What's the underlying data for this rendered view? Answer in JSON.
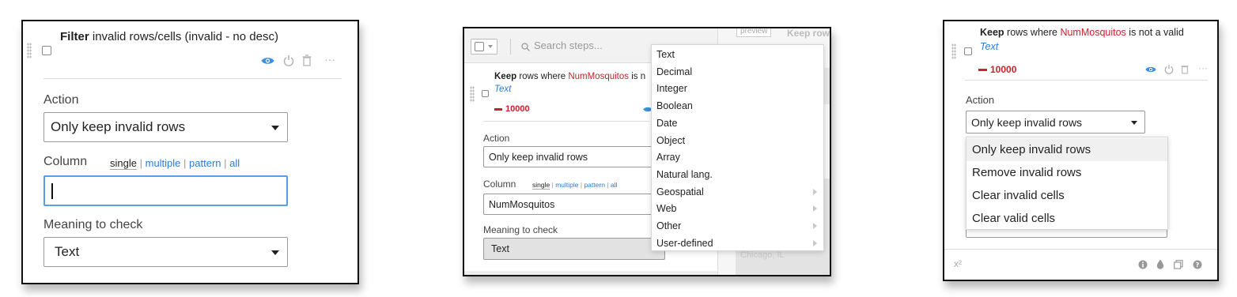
{
  "panel1": {
    "title_strong": "Filter",
    "title_rest": " invalid rows/cells (invalid - no desc)",
    "action_label": "Action",
    "action_value": "Only keep invalid rows",
    "column_label": "Column",
    "mode_single": "single",
    "mode_multiple": "multiple",
    "mode_pattern": "pattern",
    "mode_all": "all",
    "sep": "|",
    "meaning_label": "Meaning to check",
    "meaning_value": "Text"
  },
  "panel2": {
    "search_placeholder": "Search steps...",
    "step_keep": "Keep",
    "step_rows_where": " rows where ",
    "step_column": "NumMosquitos",
    "step_is": " is n",
    "step_type": "Text",
    "step_count": "10000",
    "action_label": "Action",
    "action_value": "Only keep invalid rows",
    "column_label": "Column",
    "mode_single": "single",
    "mode_multiple": "multiple",
    "mode_pattern": "pattern",
    "mode_all": "all",
    "sep": "|",
    "column_value": "NumMosquitos",
    "meaning_label": "Meaning to check",
    "meaning_value": "Text",
    "preview_tab": "preview",
    "keep_row_text": "Keep row",
    "faded_city": "Chicago, IL",
    "menu": [
      {
        "label": "Text",
        "submenu": false
      },
      {
        "label": "Decimal",
        "submenu": false
      },
      {
        "label": "Integer",
        "submenu": false
      },
      {
        "label": "Boolean",
        "submenu": false
      },
      {
        "label": "Date",
        "submenu": false
      },
      {
        "label": "Object",
        "submenu": false
      },
      {
        "label": "Array",
        "submenu": false
      },
      {
        "label": "Natural lang.",
        "submenu": false
      },
      {
        "label": "Geospatial",
        "submenu": true
      },
      {
        "label": "Web",
        "submenu": true
      },
      {
        "label": "Other",
        "submenu": true
      },
      {
        "label": "User-defined",
        "submenu": true
      }
    ]
  },
  "panel3": {
    "step_keep": "Keep",
    "step_rows_where": " rows where ",
    "step_column": "NumMosquitos",
    "step_rest": " is not a valid",
    "step_type": "Text",
    "step_count": "10000",
    "action_label": "Action",
    "action_value": "Only keep invalid rows",
    "options": [
      "Only keep invalid rows",
      "Remove invalid rows",
      "Clear invalid cells",
      "Clear valid cells"
    ],
    "footer_formula": "x²"
  },
  "colors": {
    "link_blue": "#2b7cd3",
    "alert_red": "#c8232c",
    "icon_blue": "#3b8fdc",
    "icon_gray": "#b5b5b5"
  }
}
